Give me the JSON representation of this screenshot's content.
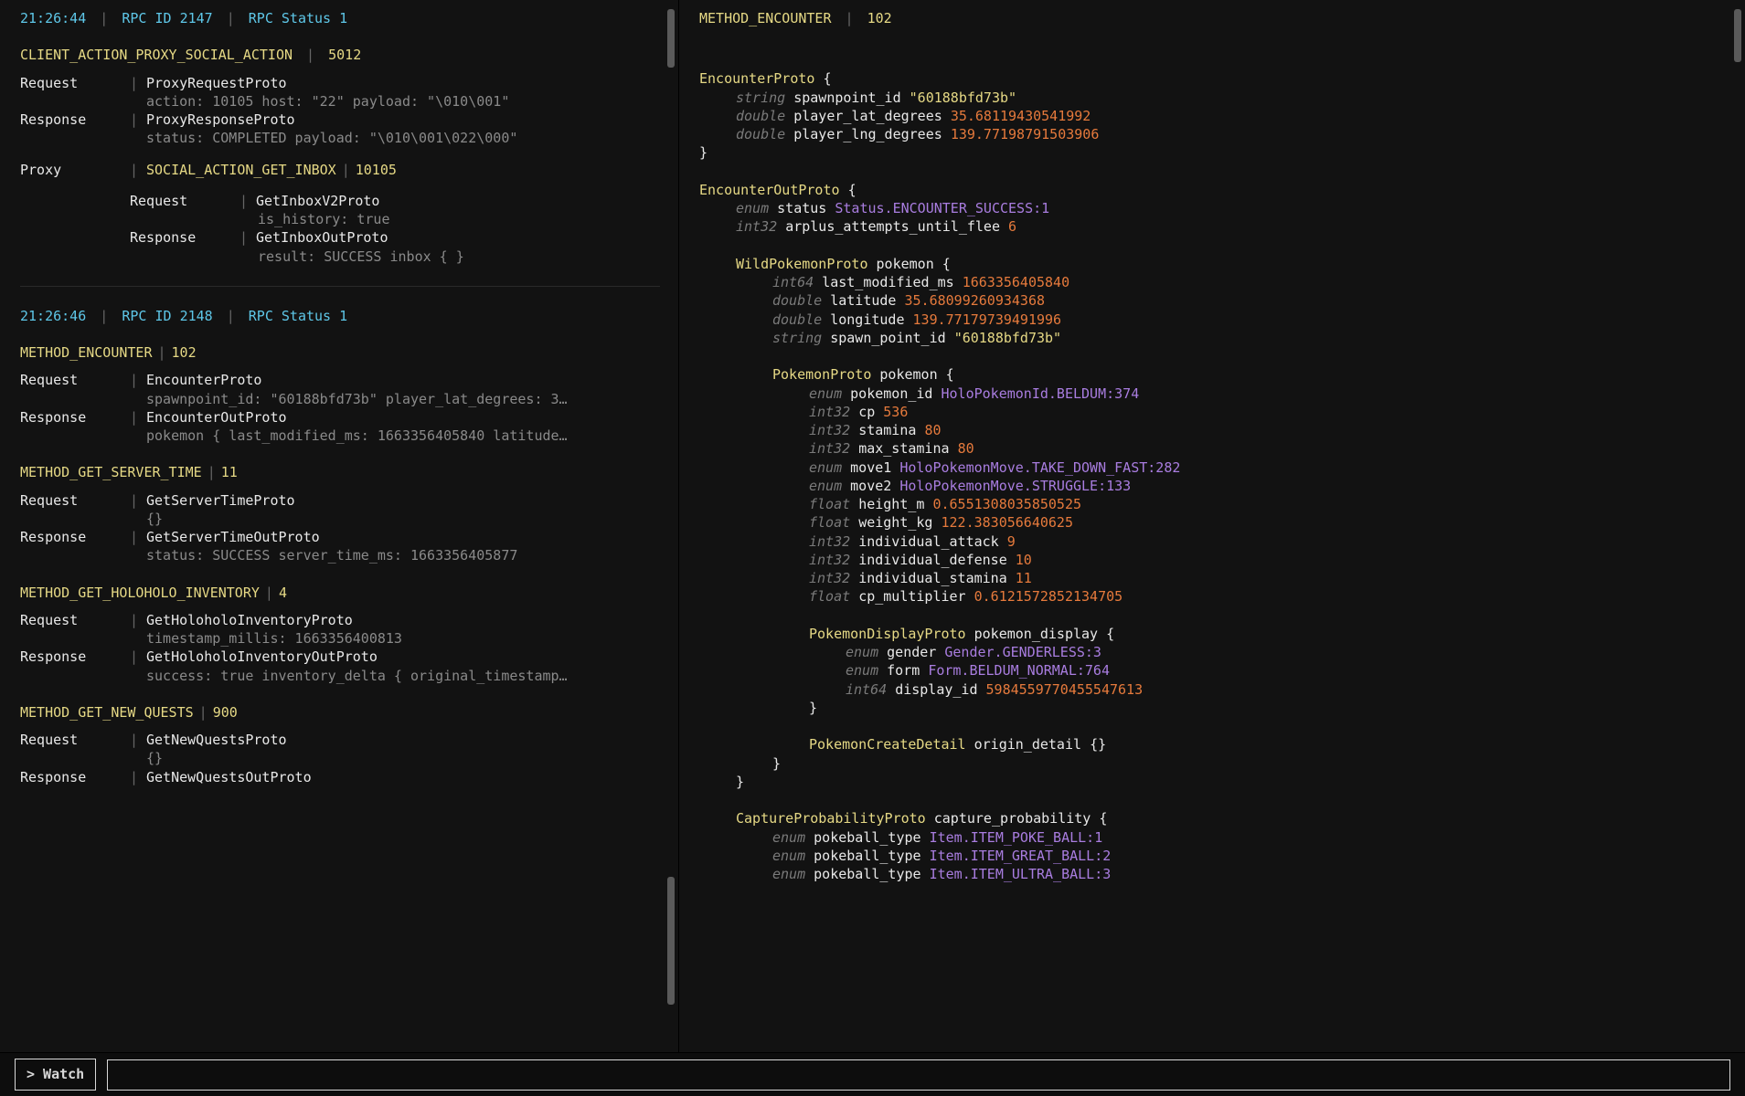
{
  "left": {
    "entry1": {
      "time": "21:26:44",
      "rpc_id_label": "RPC ID",
      "rpc_id": "2147",
      "rpc_status_label": "RPC Status",
      "rpc_status": "1",
      "method": "CLIENT_ACTION_PROXY_SOCIAL_ACTION",
      "method_id": "5012",
      "req_label": "Request",
      "req_val": "ProxyRequestProto",
      "req_sub": "action: 10105 host: \"22\" payload: \"\\010\\001\"",
      "res_label": "Response",
      "res_val": "ProxyResponseProto",
      "res_sub": "status: COMPLETED payload: \"\\010\\001\\022\\000\"",
      "proxy_label": "Proxy",
      "proxy_method": "SOCIAL_ACTION_GET_INBOX",
      "proxy_id": "10105",
      "proxy_req_label": "Request",
      "proxy_req_val": "GetInboxV2Proto",
      "proxy_req_sub": "is_history: true",
      "proxy_res_label": "Response",
      "proxy_res_val": "GetInboxOutProto",
      "proxy_res_sub": "result: SUCCESS inbox { }"
    },
    "entry2": {
      "time": "21:26:46",
      "rpc_id_label": "RPC ID",
      "rpc_id": "2148",
      "rpc_status_label": "RPC Status",
      "rpc_status": "1",
      "items": [
        {
          "method": "METHOD_ENCOUNTER",
          "id": "102",
          "req": "EncounterProto",
          "req_sub": "spawnpoint_id: \"60188bfd73b\" player_lat_degrees: 3…",
          "res": "EncounterOutProto",
          "res_sub": "pokemon { last_modified_ms: 1663356405840 latitude…"
        },
        {
          "method": "METHOD_GET_SERVER_TIME",
          "id": "11",
          "req": "GetServerTimeProto",
          "req_sub": "{}",
          "res": "GetServerTimeOutProto",
          "res_sub": "status: SUCCESS server_time_ms: 1663356405877"
        },
        {
          "method": "METHOD_GET_HOLOHOLO_INVENTORY",
          "id": "4",
          "req": "GetHoloholoInventoryProto",
          "req_sub": "timestamp_millis: 1663356400813",
          "res": "GetHoloholoInventoryOutProto",
          "res_sub": "success: true inventory_delta { original_timestamp…"
        },
        {
          "method": "METHOD_GET_NEW_QUESTS",
          "id": "900",
          "req": "GetNewQuestsProto",
          "req_sub": "{}",
          "res": "GetNewQuestsOutProto",
          "res_sub": null
        }
      ],
      "req_label": "Request",
      "res_label": "Response"
    }
  },
  "right": {
    "head_method": "METHOD_ENCOUNTER",
    "head_id": "102",
    "lines": [
      {
        "i": 0,
        "parts": [
          {
            "c": "yellow",
            "t": "EncounterProto "
          },
          {
            "c": "brace",
            "t": "{"
          }
        ]
      },
      {
        "i": 1,
        "parts": [
          {
            "c": "dimi",
            "t": "string "
          },
          {
            "c": "white",
            "t": "spawnpoint_id "
          },
          {
            "c": "yellow",
            "t": "\"60188bfd73b\""
          }
        ]
      },
      {
        "i": 1,
        "parts": [
          {
            "c": "dimi",
            "t": "double "
          },
          {
            "c": "white",
            "t": "player_lat_degrees "
          },
          {
            "c": "orange",
            "t": "35.68119430541992"
          }
        ]
      },
      {
        "i": 1,
        "parts": [
          {
            "c": "dimi",
            "t": "double "
          },
          {
            "c": "white",
            "t": "player_lng_degrees "
          },
          {
            "c": "orange",
            "t": "139.77198791503906"
          }
        ]
      },
      {
        "i": 0,
        "parts": [
          {
            "c": "brace",
            "t": "}"
          }
        ]
      },
      {
        "i": 0,
        "parts": [
          {
            "c": "",
            "t": " "
          }
        ]
      },
      {
        "i": 0,
        "parts": [
          {
            "c": "yellow",
            "t": "EncounterOutProto "
          },
          {
            "c": "brace",
            "t": "{"
          }
        ]
      },
      {
        "i": 1,
        "parts": [
          {
            "c": "dimi",
            "t": "enum "
          },
          {
            "c": "white",
            "t": "status "
          },
          {
            "c": "purple",
            "t": "Status.ENCOUNTER_SUCCESS:1"
          }
        ]
      },
      {
        "i": 1,
        "parts": [
          {
            "c": "dimi",
            "t": "int32 "
          },
          {
            "c": "white",
            "t": "arplus_attempts_until_flee "
          },
          {
            "c": "orange",
            "t": "6"
          }
        ]
      },
      {
        "i": 0,
        "parts": [
          {
            "c": "",
            "t": " "
          }
        ]
      },
      {
        "i": 1,
        "parts": [
          {
            "c": "yellow",
            "t": "WildPokemonProto "
          },
          {
            "c": "white",
            "t": "pokemon "
          },
          {
            "c": "brace",
            "t": "{"
          }
        ]
      },
      {
        "i": 2,
        "parts": [
          {
            "c": "dimi",
            "t": "int64 "
          },
          {
            "c": "white",
            "t": "last_modified_ms "
          },
          {
            "c": "orange",
            "t": "1663356405840"
          }
        ]
      },
      {
        "i": 2,
        "parts": [
          {
            "c": "dimi",
            "t": "double "
          },
          {
            "c": "white",
            "t": "latitude "
          },
          {
            "c": "orange",
            "t": "35.68099260934368"
          }
        ]
      },
      {
        "i": 2,
        "parts": [
          {
            "c": "dimi",
            "t": "double "
          },
          {
            "c": "white",
            "t": "longitude "
          },
          {
            "c": "orange",
            "t": "139.77179739491996"
          }
        ]
      },
      {
        "i": 2,
        "parts": [
          {
            "c": "dimi",
            "t": "string "
          },
          {
            "c": "white",
            "t": "spawn_point_id "
          },
          {
            "c": "yellow",
            "t": "\"60188bfd73b\""
          }
        ]
      },
      {
        "i": 0,
        "parts": [
          {
            "c": "",
            "t": " "
          }
        ]
      },
      {
        "i": 2,
        "parts": [
          {
            "c": "yellow",
            "t": "PokemonProto "
          },
          {
            "c": "white",
            "t": "pokemon "
          },
          {
            "c": "brace",
            "t": "{"
          }
        ]
      },
      {
        "i": 3,
        "parts": [
          {
            "c": "dimi",
            "t": "enum "
          },
          {
            "c": "white",
            "t": "pokemon_id "
          },
          {
            "c": "purple",
            "t": "HoloPokemonId.BELDUM:374"
          }
        ]
      },
      {
        "i": 3,
        "parts": [
          {
            "c": "dimi",
            "t": "int32 "
          },
          {
            "c": "white",
            "t": "cp "
          },
          {
            "c": "orange",
            "t": "536"
          }
        ]
      },
      {
        "i": 3,
        "parts": [
          {
            "c": "dimi",
            "t": "int32 "
          },
          {
            "c": "white",
            "t": "stamina "
          },
          {
            "c": "orange",
            "t": "80"
          }
        ]
      },
      {
        "i": 3,
        "parts": [
          {
            "c": "dimi",
            "t": "int32 "
          },
          {
            "c": "white",
            "t": "max_stamina "
          },
          {
            "c": "orange",
            "t": "80"
          }
        ]
      },
      {
        "i": 3,
        "parts": [
          {
            "c": "dimi",
            "t": "enum "
          },
          {
            "c": "white",
            "t": "move1 "
          },
          {
            "c": "purple",
            "t": "HoloPokemonMove.TAKE_DOWN_FAST:282"
          }
        ]
      },
      {
        "i": 3,
        "parts": [
          {
            "c": "dimi",
            "t": "enum "
          },
          {
            "c": "white",
            "t": "move2 "
          },
          {
            "c": "purple",
            "t": "HoloPokemonMove.STRUGGLE:133"
          }
        ]
      },
      {
        "i": 3,
        "parts": [
          {
            "c": "dimi",
            "t": "float "
          },
          {
            "c": "white",
            "t": "height_m "
          },
          {
            "c": "orange",
            "t": "0.6551308035850525"
          }
        ]
      },
      {
        "i": 3,
        "parts": [
          {
            "c": "dimi",
            "t": "float "
          },
          {
            "c": "white",
            "t": "weight_kg "
          },
          {
            "c": "orange",
            "t": "122.383056640625"
          }
        ]
      },
      {
        "i": 3,
        "parts": [
          {
            "c": "dimi",
            "t": "int32 "
          },
          {
            "c": "white",
            "t": "individual_attack "
          },
          {
            "c": "orange",
            "t": "9"
          }
        ]
      },
      {
        "i": 3,
        "parts": [
          {
            "c": "dimi",
            "t": "int32 "
          },
          {
            "c": "white",
            "t": "individual_defense "
          },
          {
            "c": "orange",
            "t": "10"
          }
        ]
      },
      {
        "i": 3,
        "parts": [
          {
            "c": "dimi",
            "t": "int32 "
          },
          {
            "c": "white",
            "t": "individual_stamina "
          },
          {
            "c": "orange",
            "t": "11"
          }
        ]
      },
      {
        "i": 3,
        "parts": [
          {
            "c": "dimi",
            "t": "float "
          },
          {
            "c": "white",
            "t": "cp_multiplier "
          },
          {
            "c": "orange",
            "t": "0.6121572852134705"
          }
        ]
      },
      {
        "i": 0,
        "parts": [
          {
            "c": "",
            "t": " "
          }
        ]
      },
      {
        "i": 3,
        "parts": [
          {
            "c": "yellow",
            "t": "PokemonDisplayProto "
          },
          {
            "c": "white",
            "t": "pokemon_display "
          },
          {
            "c": "brace",
            "t": "{"
          }
        ]
      },
      {
        "i": 4,
        "parts": [
          {
            "c": "dimi",
            "t": "enum "
          },
          {
            "c": "white",
            "t": "gender "
          },
          {
            "c": "purple",
            "t": "Gender.GENDERLESS:3"
          }
        ]
      },
      {
        "i": 4,
        "parts": [
          {
            "c": "dimi",
            "t": "enum "
          },
          {
            "c": "white",
            "t": "form "
          },
          {
            "c": "purple",
            "t": "Form.BELDUM_NORMAL:764"
          }
        ]
      },
      {
        "i": 4,
        "parts": [
          {
            "c": "dimi",
            "t": "int64 "
          },
          {
            "c": "white",
            "t": "display_id "
          },
          {
            "c": "orange",
            "t": "5984559770455547613"
          }
        ]
      },
      {
        "i": 3,
        "parts": [
          {
            "c": "brace",
            "t": "}"
          }
        ]
      },
      {
        "i": 0,
        "parts": [
          {
            "c": "",
            "t": " "
          }
        ]
      },
      {
        "i": 3,
        "parts": [
          {
            "c": "yellow",
            "t": "PokemonCreateDetail "
          },
          {
            "c": "white",
            "t": "origin_detail "
          },
          {
            "c": "brace",
            "t": "{}"
          }
        ]
      },
      {
        "i": 2,
        "parts": [
          {
            "c": "brace",
            "t": "}"
          }
        ]
      },
      {
        "i": 1,
        "parts": [
          {
            "c": "brace",
            "t": "}"
          }
        ]
      },
      {
        "i": 0,
        "parts": [
          {
            "c": "",
            "t": " "
          }
        ]
      },
      {
        "i": 1,
        "parts": [
          {
            "c": "yellow",
            "t": "CaptureProbabilityProto "
          },
          {
            "c": "white",
            "t": "capture_probability "
          },
          {
            "c": "brace",
            "t": "{"
          }
        ]
      },
      {
        "i": 2,
        "parts": [
          {
            "c": "dimi",
            "t": "enum "
          },
          {
            "c": "white",
            "t": "pokeball_type "
          },
          {
            "c": "purple",
            "t": "Item.ITEM_POKE_BALL:1"
          }
        ]
      },
      {
        "i": 2,
        "parts": [
          {
            "c": "dimi",
            "t": "enum "
          },
          {
            "c": "white",
            "t": "pokeball_type "
          },
          {
            "c": "purple",
            "t": "Item.ITEM_GREAT_BALL:2"
          }
        ]
      },
      {
        "i": 2,
        "parts": [
          {
            "c": "dimi",
            "t": "enum "
          },
          {
            "c": "white",
            "t": "pokeball_type "
          },
          {
            "c": "purple",
            "t": "Item.ITEM_ULTRA_BALL:3"
          }
        ]
      }
    ]
  },
  "watch": {
    "label": "> Watch",
    "value": ""
  }
}
